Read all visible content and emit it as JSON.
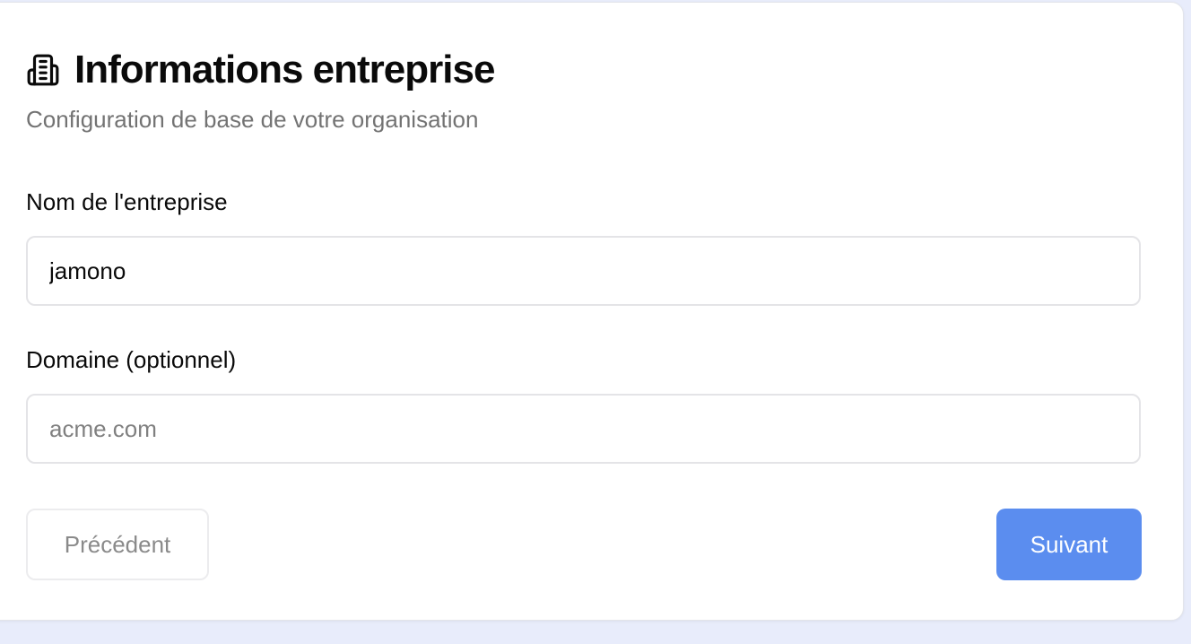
{
  "card": {
    "title": "Informations entreprise",
    "subtitle": "Configuration de base de votre organisation",
    "icon": "building-icon"
  },
  "form": {
    "company_name": {
      "label": "Nom de l'entreprise",
      "value": "jamono"
    },
    "domain": {
      "label": "Domaine (optionnel)",
      "value": "",
      "placeholder": "acme.com"
    }
  },
  "actions": {
    "previous_label": "Précédent",
    "next_label": "Suivant"
  },
  "colors": {
    "accent": "#5b8def",
    "page_background": "#e8ecfb"
  }
}
